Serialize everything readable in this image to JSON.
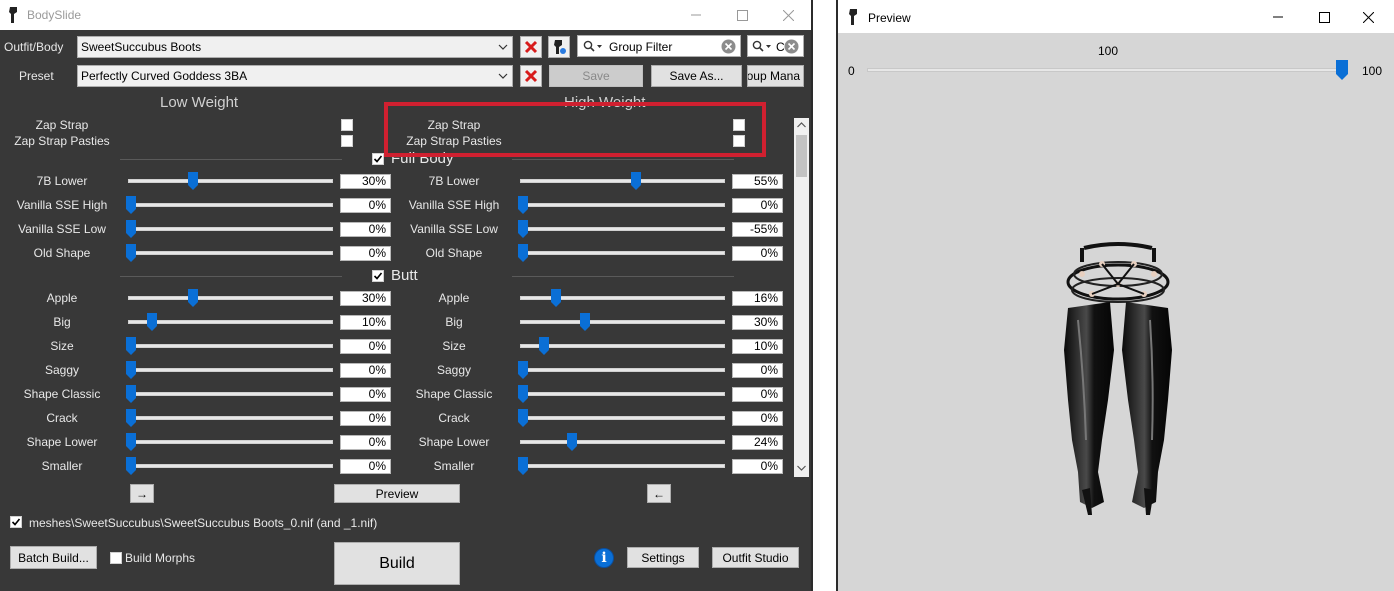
{
  "bodyslide": {
    "title": "BodySlide",
    "outfit_label": "Outfit/Body",
    "outfit_value": "SweetSuccubus Boots",
    "preset_label": "Preset",
    "preset_value": "Perfectly Curved Goddess 3BA",
    "group_filter_placeholder": "Group Filter",
    "second_filter_text": "C",
    "save_label": "Save",
    "save_as_label": "Save As...",
    "group_manager_label": "oup Mana",
    "low_weight_header": "Low Weight",
    "high_weight_header": "High Weight",
    "zap_low": [
      {
        "label": "Zap Strap"
      },
      {
        "label": "Zap Strap Pasties"
      }
    ],
    "zap_high": [
      {
        "label": "Zap Strap"
      },
      {
        "label": "Zap Strap Pasties"
      }
    ],
    "groups": [
      {
        "title": "Full Body",
        "checked": true,
        "sliders": [
          {
            "label": "7B Lower",
            "low": "30%",
            "high": "55%",
            "low_pct": 30,
            "high_pct": 55
          },
          {
            "label": "Vanilla SSE High",
            "low": "0%",
            "high": "0%",
            "low_pct": 0,
            "high_pct": 0
          },
          {
            "label": "Vanilla SSE Low",
            "low": "0%",
            "high": "-55%",
            "low_pct": 0,
            "high_pct": 0
          },
          {
            "label": "Old Shape",
            "low": "0%",
            "high": "0%",
            "low_pct": 0,
            "high_pct": 0
          }
        ]
      },
      {
        "title": "Butt",
        "checked": true,
        "sliders": [
          {
            "label": "Apple",
            "low": "30%",
            "high": "16%",
            "low_pct": 30,
            "high_pct": 16
          },
          {
            "label": "Big",
            "low": "10%",
            "high": "30%",
            "low_pct": 10,
            "high_pct": 30
          },
          {
            "label": "Size",
            "low": "0%",
            "high": "10%",
            "low_pct": 0,
            "high_pct": 10
          },
          {
            "label": "Saggy",
            "low": "0%",
            "high": "0%",
            "low_pct": 0,
            "high_pct": 0
          },
          {
            "label": "Shape Classic",
            "low": "0%",
            "high": "0%",
            "low_pct": 0,
            "high_pct": 0
          },
          {
            "label": "Crack",
            "low": "0%",
            "high": "0%",
            "low_pct": 0,
            "high_pct": 0
          },
          {
            "label": "Shape Lower",
            "low": "0%",
            "high": "24%",
            "low_pct": 0,
            "high_pct": 24
          },
          {
            "label": "Smaller",
            "low": "0%",
            "high": "0%",
            "low_pct": 0,
            "high_pct": 0
          }
        ]
      }
    ],
    "arrow_right_label": "→",
    "preview_label": "Preview",
    "arrow_left_label": "←",
    "output_path": "meshes\\SweetSuccubus\\SweetSuccubus Boots_0.nif (and _1.nif)",
    "batch_build_label": "Batch Build...",
    "build_morphs_label": "Build Morphs",
    "build_label": "Build",
    "settings_label": "Settings",
    "outfit_studio_label": "Outfit Studio",
    "info_glyph": "i",
    "accent_color": "#0a6fd6",
    "highlight_color": "#d02030"
  },
  "preview": {
    "title": "Preview",
    "weight_value": "100",
    "slider_min": "0",
    "slider_max": "100",
    "weight_fraction": 1.0
  }
}
